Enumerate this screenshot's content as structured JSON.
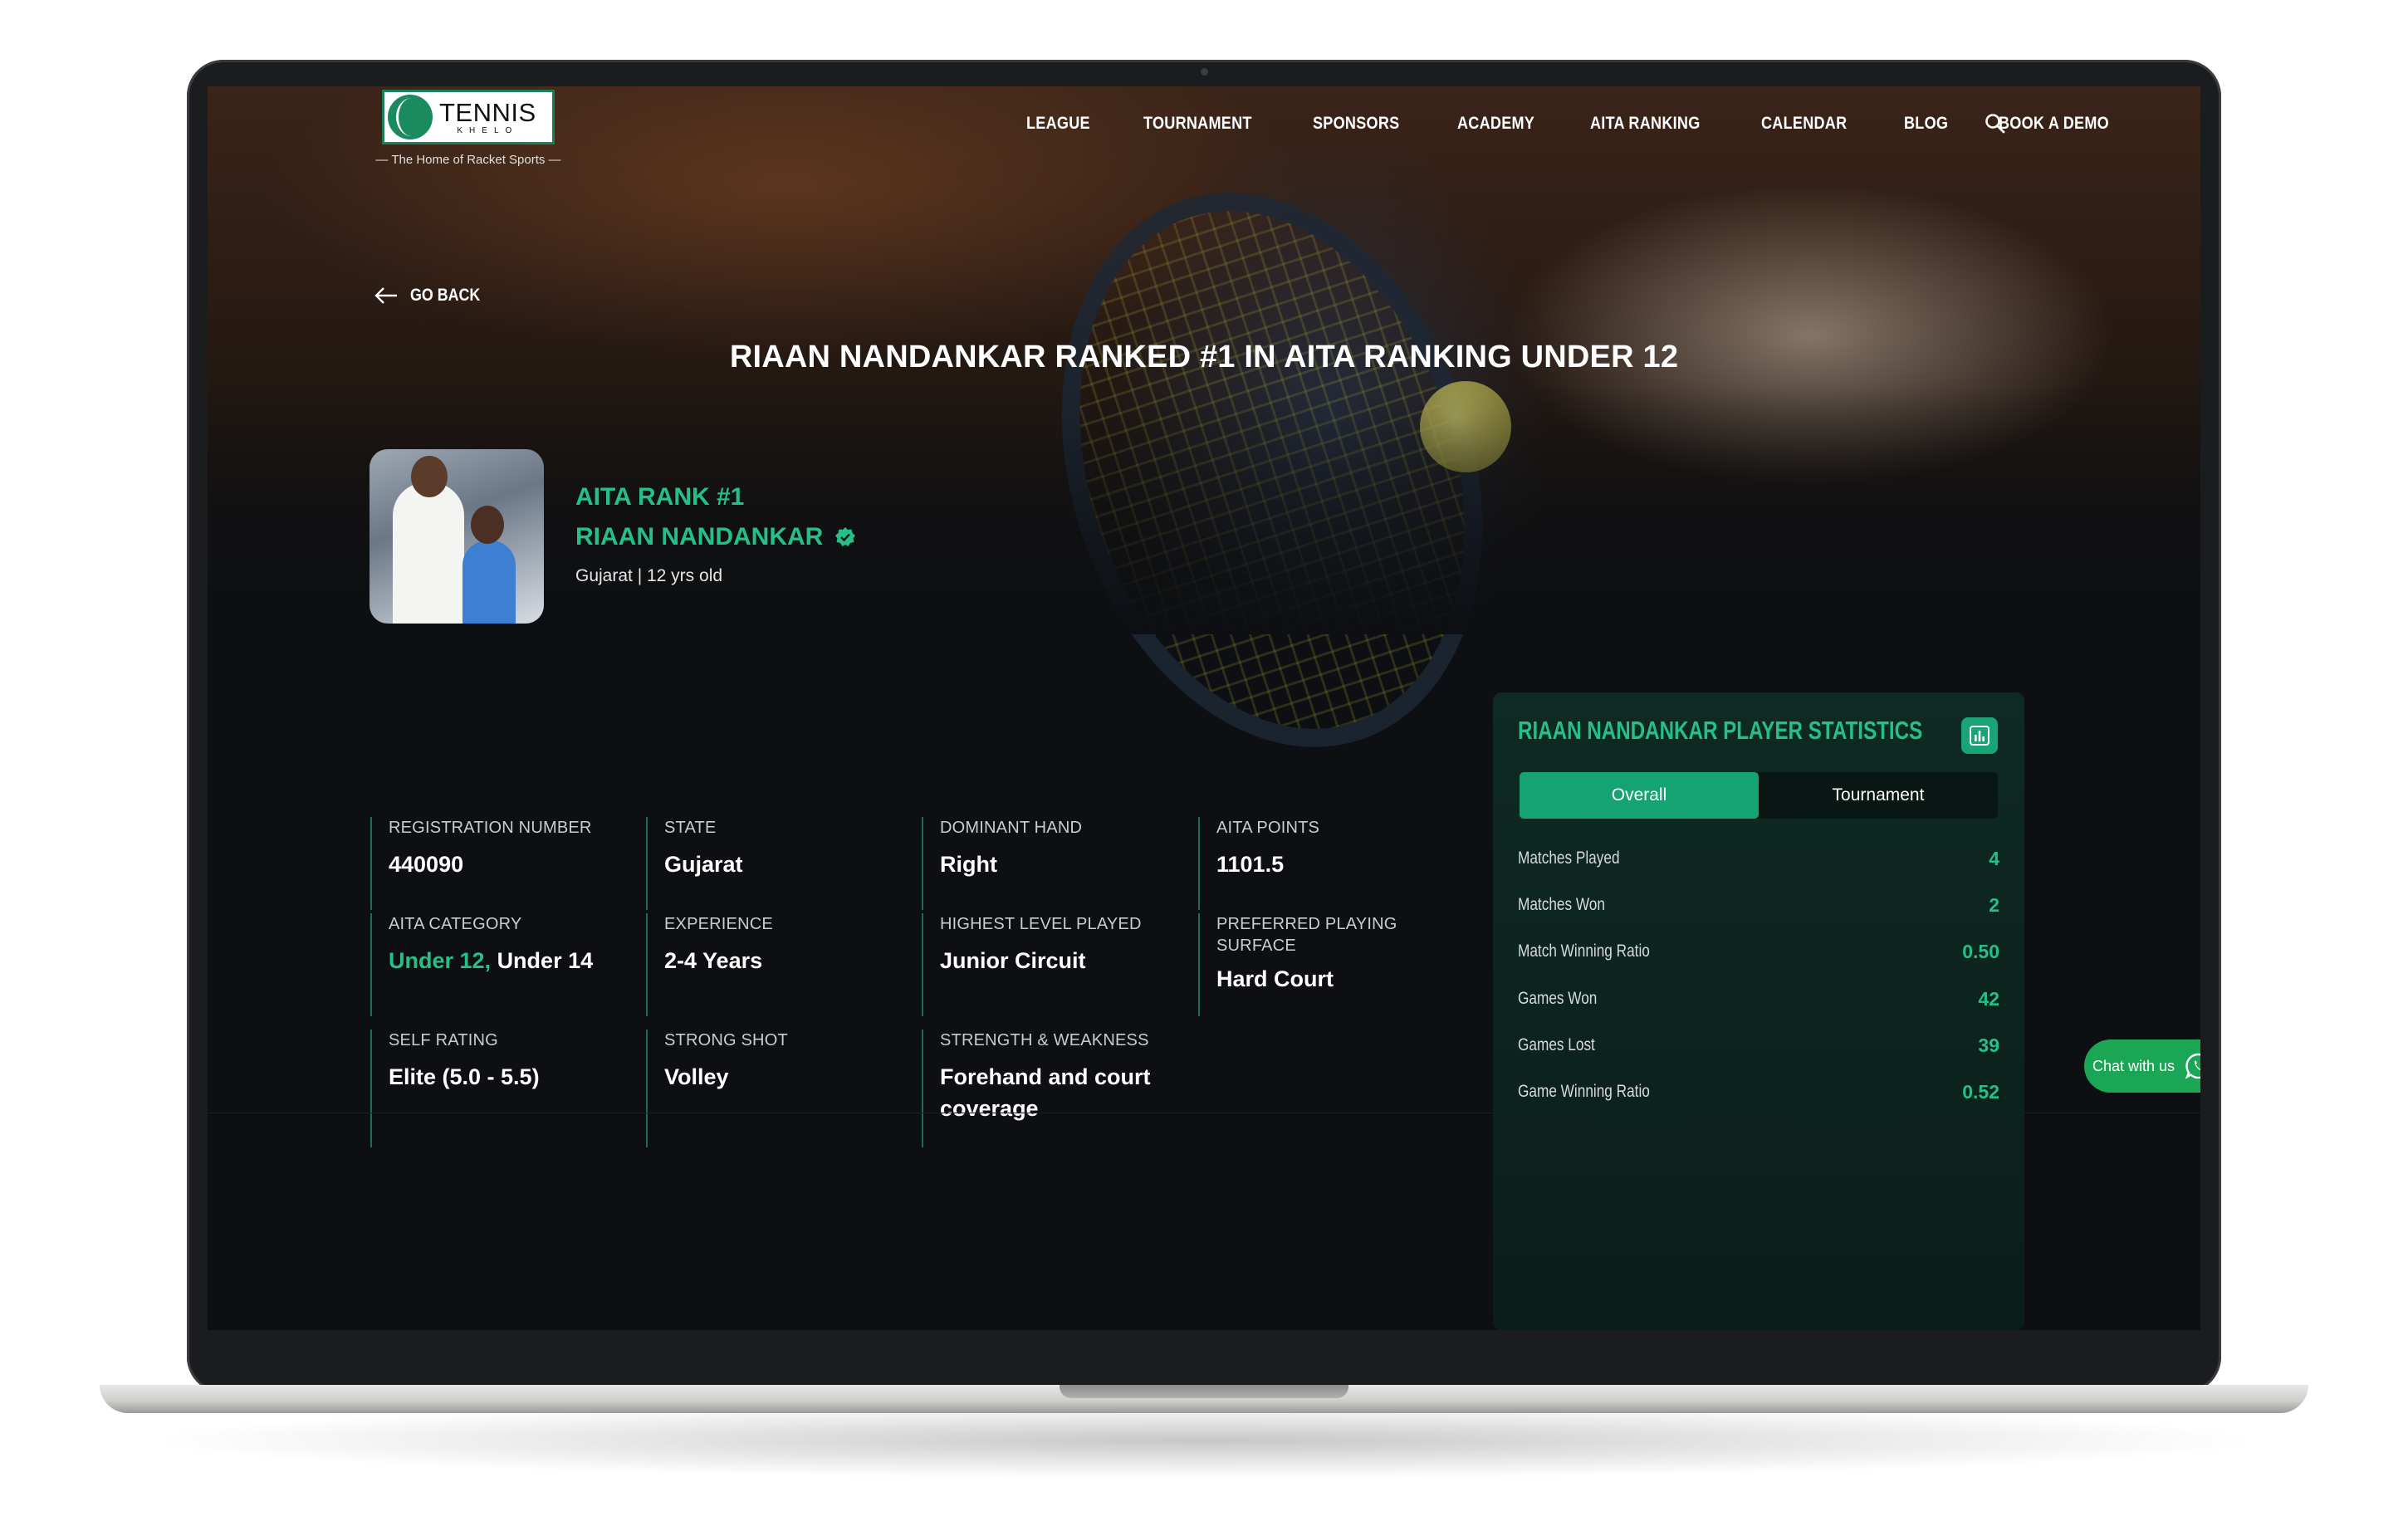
{
  "header": {
    "logo_text": "TENNIS",
    "logo_subtext": "KHELO",
    "tagline": "— The Home of Racket Sports —",
    "nav": [
      "LEAGUE",
      "TOURNAMENT",
      "SPONSORS",
      "ACADEMY",
      "AITA RANKING",
      "CALENDAR",
      "BLOG",
      "BOOK A DEMO"
    ]
  },
  "back_label": "GO BACK",
  "page_title": "RIAAN NANDANKAR RANKED #1 IN AITA RANKING UNDER 12",
  "player": {
    "rank_label": "AITA RANK #1",
    "name": "RIAAN NANDANKAR",
    "subtitle": "Gujarat | 12 yrs old"
  },
  "info": {
    "registration_number": {
      "label": "REGISTRATION NUMBER",
      "value": "440090"
    },
    "state": {
      "label": "STATE",
      "value": "Gujarat"
    },
    "dominant_hand": {
      "label": "DOMINANT HAND",
      "value": "Right"
    },
    "aita_points": {
      "label": "AITA POINTS",
      "value": "1101.5"
    },
    "aita_category": {
      "label": "AITA CATEGORY",
      "value_primary": "Under 12,",
      "value_secondary": "Under 14"
    },
    "experience": {
      "label": "EXPERIENCE",
      "value": "2-4 Years"
    },
    "highest_level": {
      "label": "HIGHEST LEVEL PLAYED",
      "value": "Junior Circuit"
    },
    "preferred_surface": {
      "label": "PREFERRED PLAYING SURFACE",
      "value": "Hard Court"
    },
    "self_rating": {
      "label": "SELF RATING",
      "value": "Elite (5.0 - 5.5)"
    },
    "strong_shot": {
      "label": "STRONG SHOT",
      "value": "Volley"
    },
    "strength_weakness": {
      "label": "STRENGTH & WEAKNESS",
      "value": "Forehand and court coverage"
    }
  },
  "stats": {
    "title": "RIAAN NANDANKAR PLAYER STATISTICS",
    "tabs": [
      "Overall",
      "Tournament"
    ],
    "active_tab": "Overall",
    "rows": [
      {
        "label": "Matches Played",
        "value": "4"
      },
      {
        "label": "Matches Won",
        "value": "2"
      },
      {
        "label": "Match Winning Ratio",
        "value": "0.50"
      },
      {
        "label": "Games Won",
        "value": "42"
      },
      {
        "label": "Games Lost",
        "value": "39"
      },
      {
        "label": "Game Winning Ratio",
        "value": "0.52"
      }
    ]
  },
  "chat_label": "Chat with us",
  "colors": {
    "accent": "#25c08a",
    "accent_button": "#16a374",
    "chat_green": "#1aa654",
    "background": "#0d0f12"
  },
  "icons": [
    "search-icon",
    "arrow-left-icon",
    "verified-icon",
    "bar-chart-icon",
    "whatsapp-icon"
  ]
}
